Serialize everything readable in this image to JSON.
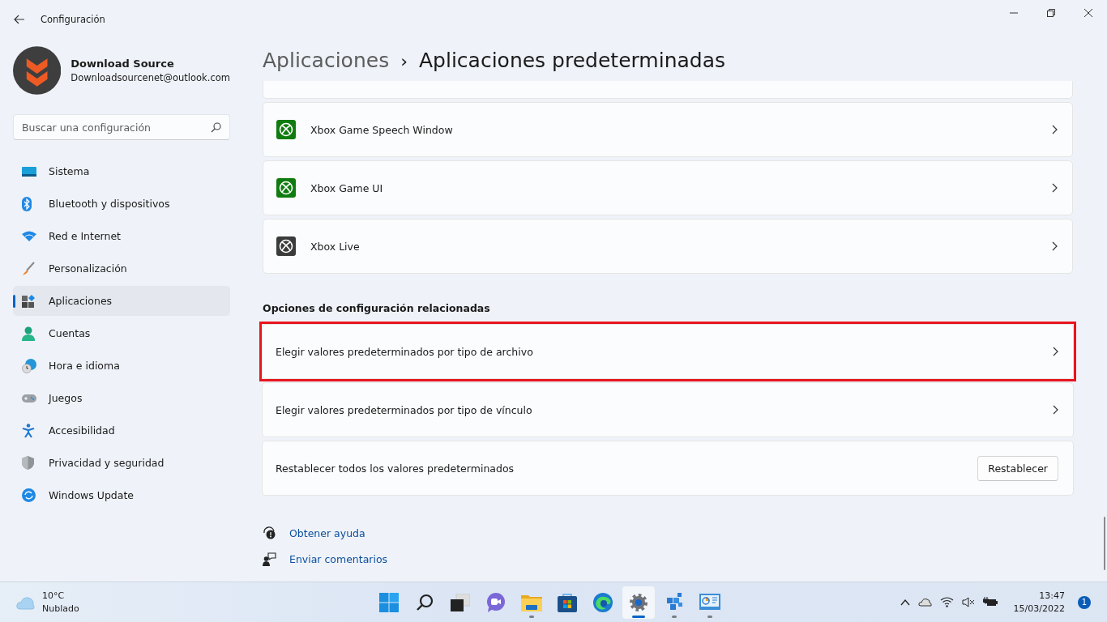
{
  "window": {
    "title": "Configuración"
  },
  "profile": {
    "name": "Download Source",
    "email": "Downloadsourcenet@outlook.com"
  },
  "search": {
    "placeholder": "Buscar una configuración"
  },
  "sidebar": {
    "items": [
      {
        "label": "Sistema",
        "kind": "system",
        "selected": false
      },
      {
        "label": "Bluetooth y dispositivos",
        "kind": "bluetooth",
        "selected": false
      },
      {
        "label": "Red e Internet",
        "kind": "network",
        "selected": false
      },
      {
        "label": "Personalización",
        "kind": "brush",
        "selected": false
      },
      {
        "label": "Aplicaciones",
        "kind": "apps",
        "selected": true
      },
      {
        "label": "Cuentas",
        "kind": "person",
        "selected": false
      },
      {
        "label": "Hora e idioma",
        "kind": "clock",
        "selected": false
      },
      {
        "label": "Juegos",
        "kind": "gamepad",
        "selected": false
      },
      {
        "label": "Accesibilidad",
        "kind": "accessibility",
        "selected": false
      },
      {
        "label": "Privacidad y seguridad",
        "kind": "shield",
        "selected": false
      },
      {
        "label": "Windows Update",
        "kind": "update",
        "selected": false
      }
    ]
  },
  "breadcrumb": {
    "parent": "Aplicaciones",
    "separator": "›",
    "current": "Aplicaciones predeterminadas"
  },
  "apps": [
    {
      "name": "Xbox Game Speech Window",
      "color": "#107c10"
    },
    {
      "name": "Xbox Game UI",
      "color": "#107c10"
    },
    {
      "name": "Xbox Live",
      "color": "#3b3b3b"
    }
  ],
  "related": {
    "heading": "Opciones de configuración relacionadas",
    "options": [
      {
        "label": "Elegir valores predeterminados por tipo de archivo",
        "kind": "link",
        "highlighted": true
      },
      {
        "label": "Elegir valores predeterminados por tipo de vínculo",
        "kind": "link",
        "highlighted": false
      },
      {
        "label": "Restablecer todos los valores predeterminados",
        "kind": "button",
        "button": "Restablecer",
        "highlighted": false
      }
    ]
  },
  "help_links": [
    {
      "label": "Obtener ayuda",
      "kind": "help"
    },
    {
      "label": "Enviar comentarios",
      "kind": "feedback"
    }
  ],
  "taskbar": {
    "weather": {
      "temperature": "10°C",
      "condition": "Nublado"
    },
    "apps": [
      {
        "kind": "start",
        "running": false,
        "selected": false
      },
      {
        "kind": "search",
        "running": false,
        "selected": false
      },
      {
        "kind": "taskview",
        "running": false,
        "selected": false
      },
      {
        "kind": "chat",
        "running": false,
        "selected": false
      },
      {
        "kind": "folder",
        "running": true,
        "selected": false
      },
      {
        "kind": "store",
        "running": false,
        "selected": false
      },
      {
        "kind": "browser",
        "running": false,
        "selected": false
      },
      {
        "kind": "settings",
        "running": true,
        "selected": true
      },
      {
        "kind": "cubes",
        "running": true,
        "selected": false
      },
      {
        "kind": "chart",
        "running": true,
        "selected": false
      }
    ],
    "time": "13:47",
    "date": "15/03/2022",
    "notifications": "1"
  }
}
